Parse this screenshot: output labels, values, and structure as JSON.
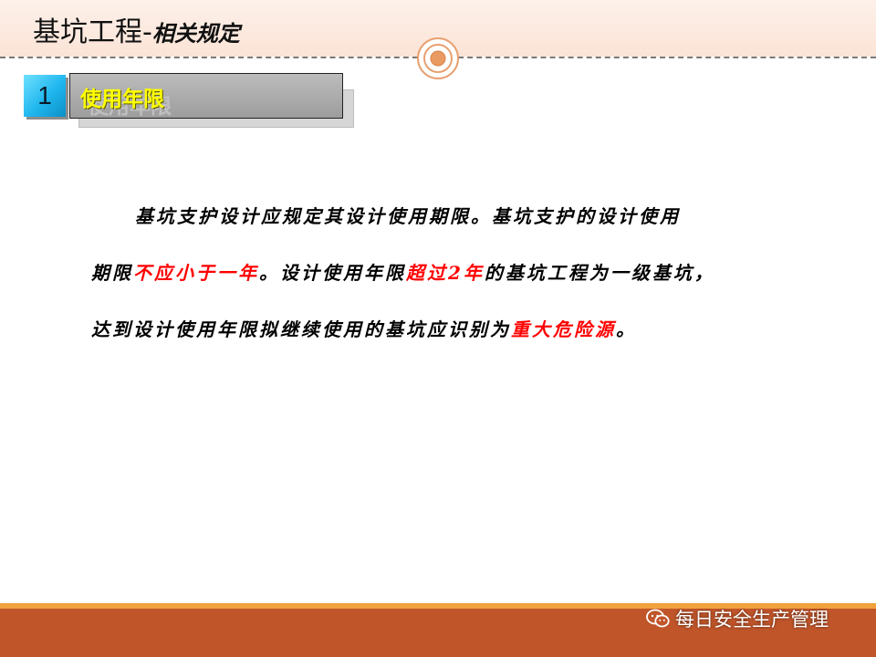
{
  "header": {
    "title_main": "基坑工程",
    "title_sep": "-",
    "title_sub": "相关规定"
  },
  "section": {
    "number": "1",
    "label": "使用年限"
  },
  "body": {
    "lines": [
      [
        {
          "text": "基坑支护设计应规定其设计使用期限。基坑支护的设计使用",
          "highlight": false
        }
      ],
      [
        {
          "text": "期限",
          "highlight": false
        },
        {
          "text": "不应小于一年",
          "highlight": true
        },
        {
          "text": "。设计使用年限",
          "highlight": false
        },
        {
          "text": "超过2年",
          "highlight": true
        },
        {
          "text": "的基坑工程为一级基坑，",
          "highlight": false
        }
      ],
      [
        {
          "text": "达到设计使用年限拟继续使用的基坑应识别为",
          "highlight": false
        },
        {
          "text": "重大危险源",
          "highlight": true
        },
        {
          "text": "。",
          "highlight": false
        }
      ]
    ]
  },
  "footer": {
    "brand_text": "每日安全生产管理",
    "brand_icon": "wechat-icon"
  },
  "colors": {
    "highlight": "#ff0000",
    "section_label": "#ffff00",
    "number_box": "#1fb6ee",
    "footer_band": "#c0552a",
    "footer_stripe": "#f0a23c"
  }
}
